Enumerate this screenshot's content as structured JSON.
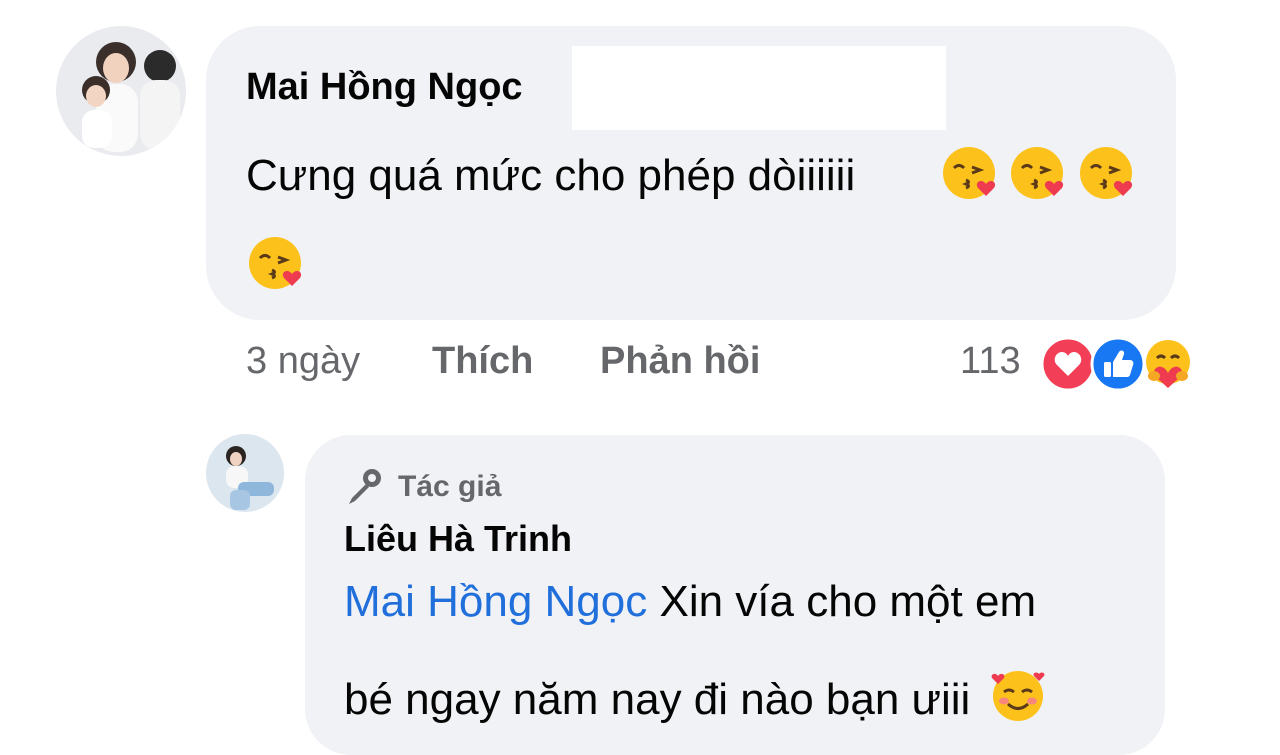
{
  "comment": {
    "author": "Mai Hồng Ngọc",
    "text": "Cưng quá mức cho phép dòiiiiii",
    "emojis": [
      "kissing-heart",
      "kissing-heart",
      "kissing-heart",
      "kissing-heart"
    ],
    "time": "3 ngày",
    "like_label": "Thích",
    "reply_label": "Phản hồi",
    "reaction_count": "113",
    "reactions": [
      "love",
      "like",
      "care"
    ]
  },
  "reply": {
    "badge": "Tác giả",
    "author": "Liêu Hà Trinh",
    "mention": "Mai Hồng Ngọc",
    "line1_text": " Xin vía cho một em",
    "line2_text": "bé ngay năm nay đi nào bạn ưiii",
    "emoji": "smiling-hearts"
  },
  "colors": {
    "bubble": "#f0f2f5",
    "secondary_text": "#65676b",
    "mention": "#216fdb",
    "love": "#f33e58",
    "like": "#1877f2",
    "emoji_yellow": "#fcc21b"
  }
}
